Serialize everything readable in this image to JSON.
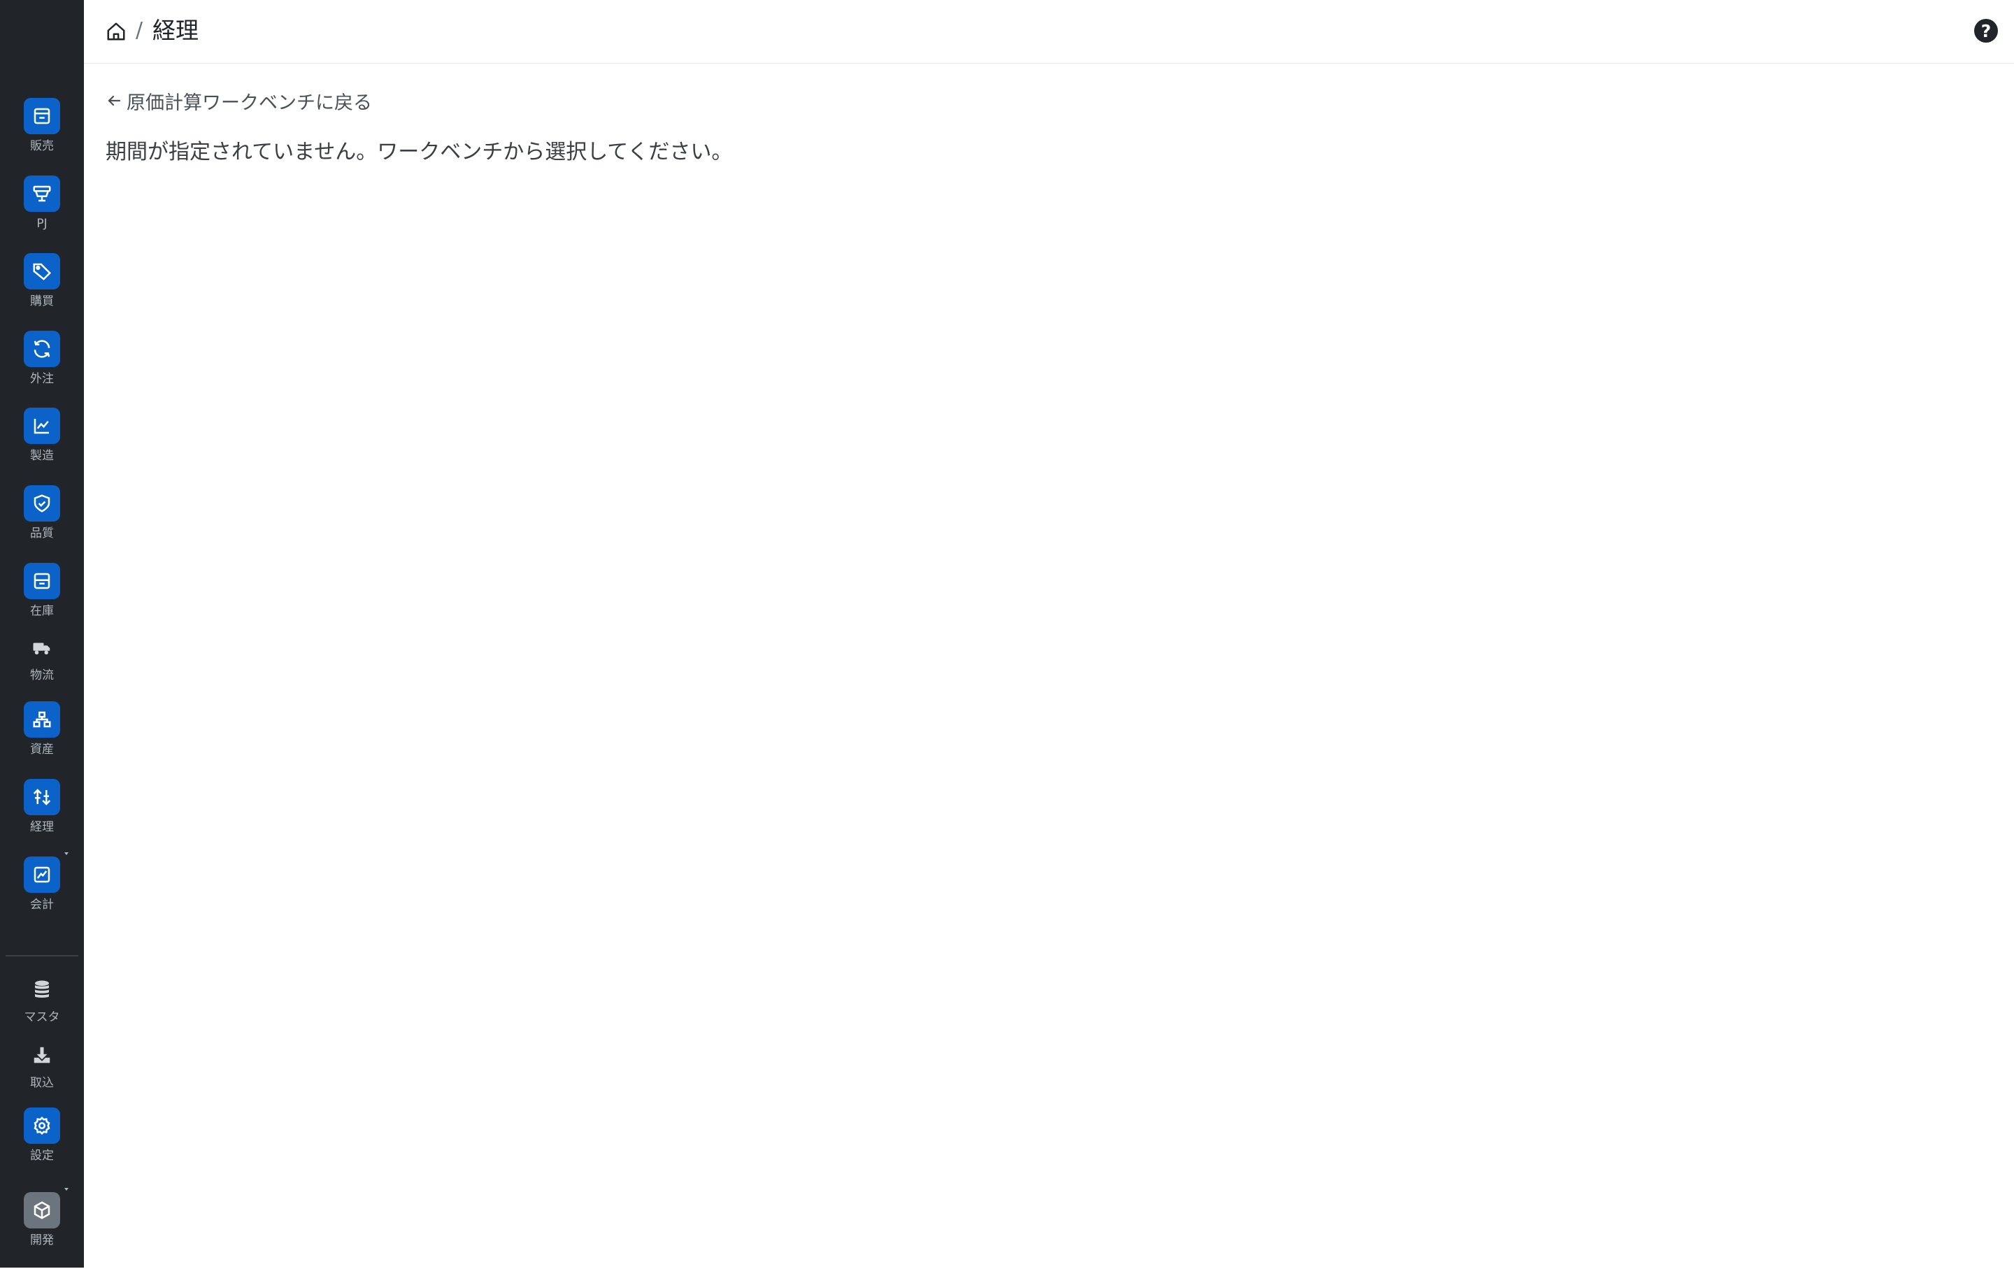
{
  "breadcrumb": {
    "current": "経理",
    "separator": "/"
  },
  "header": {
    "help_label": "?"
  },
  "back_link": {
    "label": "原価計算ワークベンチに戻る"
  },
  "message": "期間が指定されていません。ワークベンチから選択してください。",
  "sidebar": {
    "items": [
      {
        "label": "販売",
        "icon": "storefront-icon"
      },
      {
        "label": "PJ",
        "icon": "presentation-icon"
      },
      {
        "label": "購買",
        "icon": "tag-icon"
      },
      {
        "label": "外注",
        "icon": "refresh-icon"
      },
      {
        "label": "製造",
        "icon": "factory-icon"
      },
      {
        "label": "品質",
        "icon": "shield-check-icon"
      },
      {
        "label": "在庫",
        "icon": "box-icon"
      },
      {
        "label": "物流",
        "icon": "truck-icon"
      },
      {
        "label": "資産",
        "icon": "network-icon"
      },
      {
        "label": "経理",
        "icon": "transfer-icon"
      },
      {
        "label": "会計",
        "icon": "chart-icon"
      },
      {
        "label": "マスタ",
        "icon": "database-icon"
      },
      {
        "label": "取込",
        "icon": "download-icon"
      },
      {
        "label": "設定",
        "icon": "gear-icon"
      },
      {
        "label": "開発",
        "icon": "cube-icon"
      }
    ]
  },
  "colors": {
    "sidebar": "#212529",
    "accent": "#0b63c9",
    "dev_tile": "#6c757d"
  }
}
